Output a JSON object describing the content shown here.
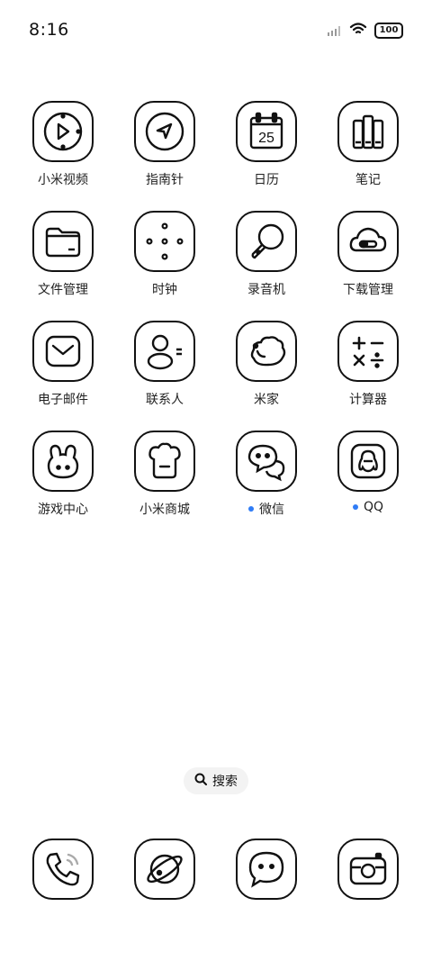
{
  "status_bar": {
    "time": "8:16",
    "battery": "100",
    "icons": [
      "signal-icon",
      "wifi-icon",
      "battery-icon"
    ]
  },
  "apps": [
    {
      "label": "小米视频",
      "icon": "video-play-icon"
    },
    {
      "label": "指南针",
      "icon": "compass-icon"
    },
    {
      "label": "日历",
      "icon": "calendar-icon",
      "date": "25"
    },
    {
      "label": "笔记",
      "icon": "notes-books-icon"
    },
    {
      "label": "文件管理",
      "icon": "folder-icon"
    },
    {
      "label": "时钟",
      "icon": "clock-dots-icon"
    },
    {
      "label": "录音机",
      "icon": "microphone-icon"
    },
    {
      "label": "下载管理",
      "icon": "cloud-download-icon"
    },
    {
      "label": "电子邮件",
      "icon": "mail-icon"
    },
    {
      "label": "联系人",
      "icon": "contact-icon"
    },
    {
      "label": "米家",
      "icon": "mijia-icon"
    },
    {
      "label": "计算器",
      "icon": "calculator-icon"
    },
    {
      "label": "游戏中心",
      "icon": "game-bunny-icon"
    },
    {
      "label": "小米商城",
      "icon": "mi-store-icon"
    },
    {
      "label": "微信",
      "icon": "wechat-icon",
      "badge": true
    },
    {
      "label": "QQ",
      "icon": "qq-penguin-icon",
      "badge": true
    }
  ],
  "search": {
    "label": "搜索"
  },
  "dock": [
    {
      "name": "phone",
      "icon": "phone-icon"
    },
    {
      "name": "browser",
      "icon": "browser-planet-icon"
    },
    {
      "name": "messages",
      "icon": "message-bubble-icon"
    },
    {
      "name": "camera",
      "icon": "camera-icon"
    }
  ],
  "colors": {
    "badge": "#2f7cf6",
    "outline": "#111111",
    "background": "#ffffff"
  }
}
